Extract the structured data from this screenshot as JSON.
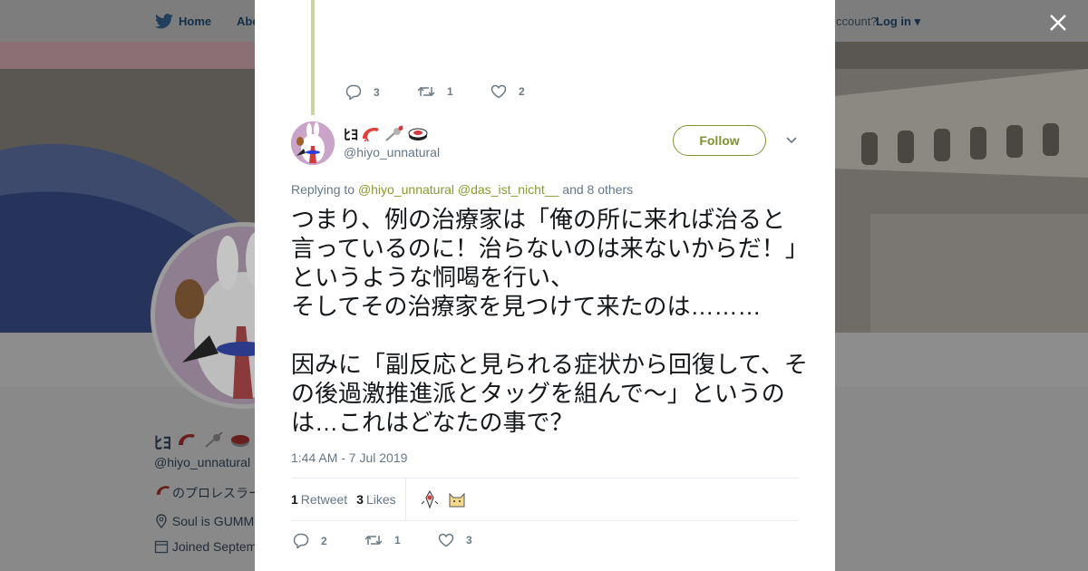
{
  "background_page": {
    "nav": {
      "home_label": "Home",
      "about_label": "Abo",
      "account_prompt": "ccount?",
      "login_label": "Log in"
    },
    "profile": {
      "display_name": "ﾋﾖ",
      "handle": "@hiyo_unnatural",
      "bio": "のプロレスラー",
      "location": "Soul is GUMM",
      "joined": "Joined Septem"
    }
  },
  "tweet_thread": {
    "parent_actions": {
      "replies": "3",
      "retweets": "1",
      "likes": "2"
    },
    "author": {
      "display_name": "ﾋﾖ",
      "handle": "@hiyo_unnatural",
      "emoji_names": [
        "shrimp-icon",
        "skewer-icon",
        "sushi-icon"
      ]
    },
    "follow_label": "Follow",
    "replying": {
      "prefix": "Replying to",
      "mention1": "@hiyo_unnatural",
      "mention2": "@das_ist_nicht__",
      "suffix": "and 8 others"
    },
    "text": "つまり、例の治療家は「俺の所に来れば治ると言っているのに！治らないのは来ないからだ！」というような恫喝を行い、\nそしてその治療家を見つけて来たのは………\n\n因みに「副反応と見られる症状から回復して、その後過激推進派とタッグを組んで〜」というのは…これはどなたの事で？",
    "timestamp": "1:44 AM - 7 Jul 2019",
    "stats": {
      "retweets_count": "1",
      "retweets_label": "Retweet",
      "likes_count": "3",
      "likes_label": "Likes"
    },
    "actions": {
      "replies": "2",
      "retweets": "1",
      "likes": "3"
    }
  },
  "colors": {
    "accent": "#83922e",
    "link": "#8a9a2e",
    "thread_line": "#c9d3a6",
    "overlay": "#9a9a9a"
  }
}
